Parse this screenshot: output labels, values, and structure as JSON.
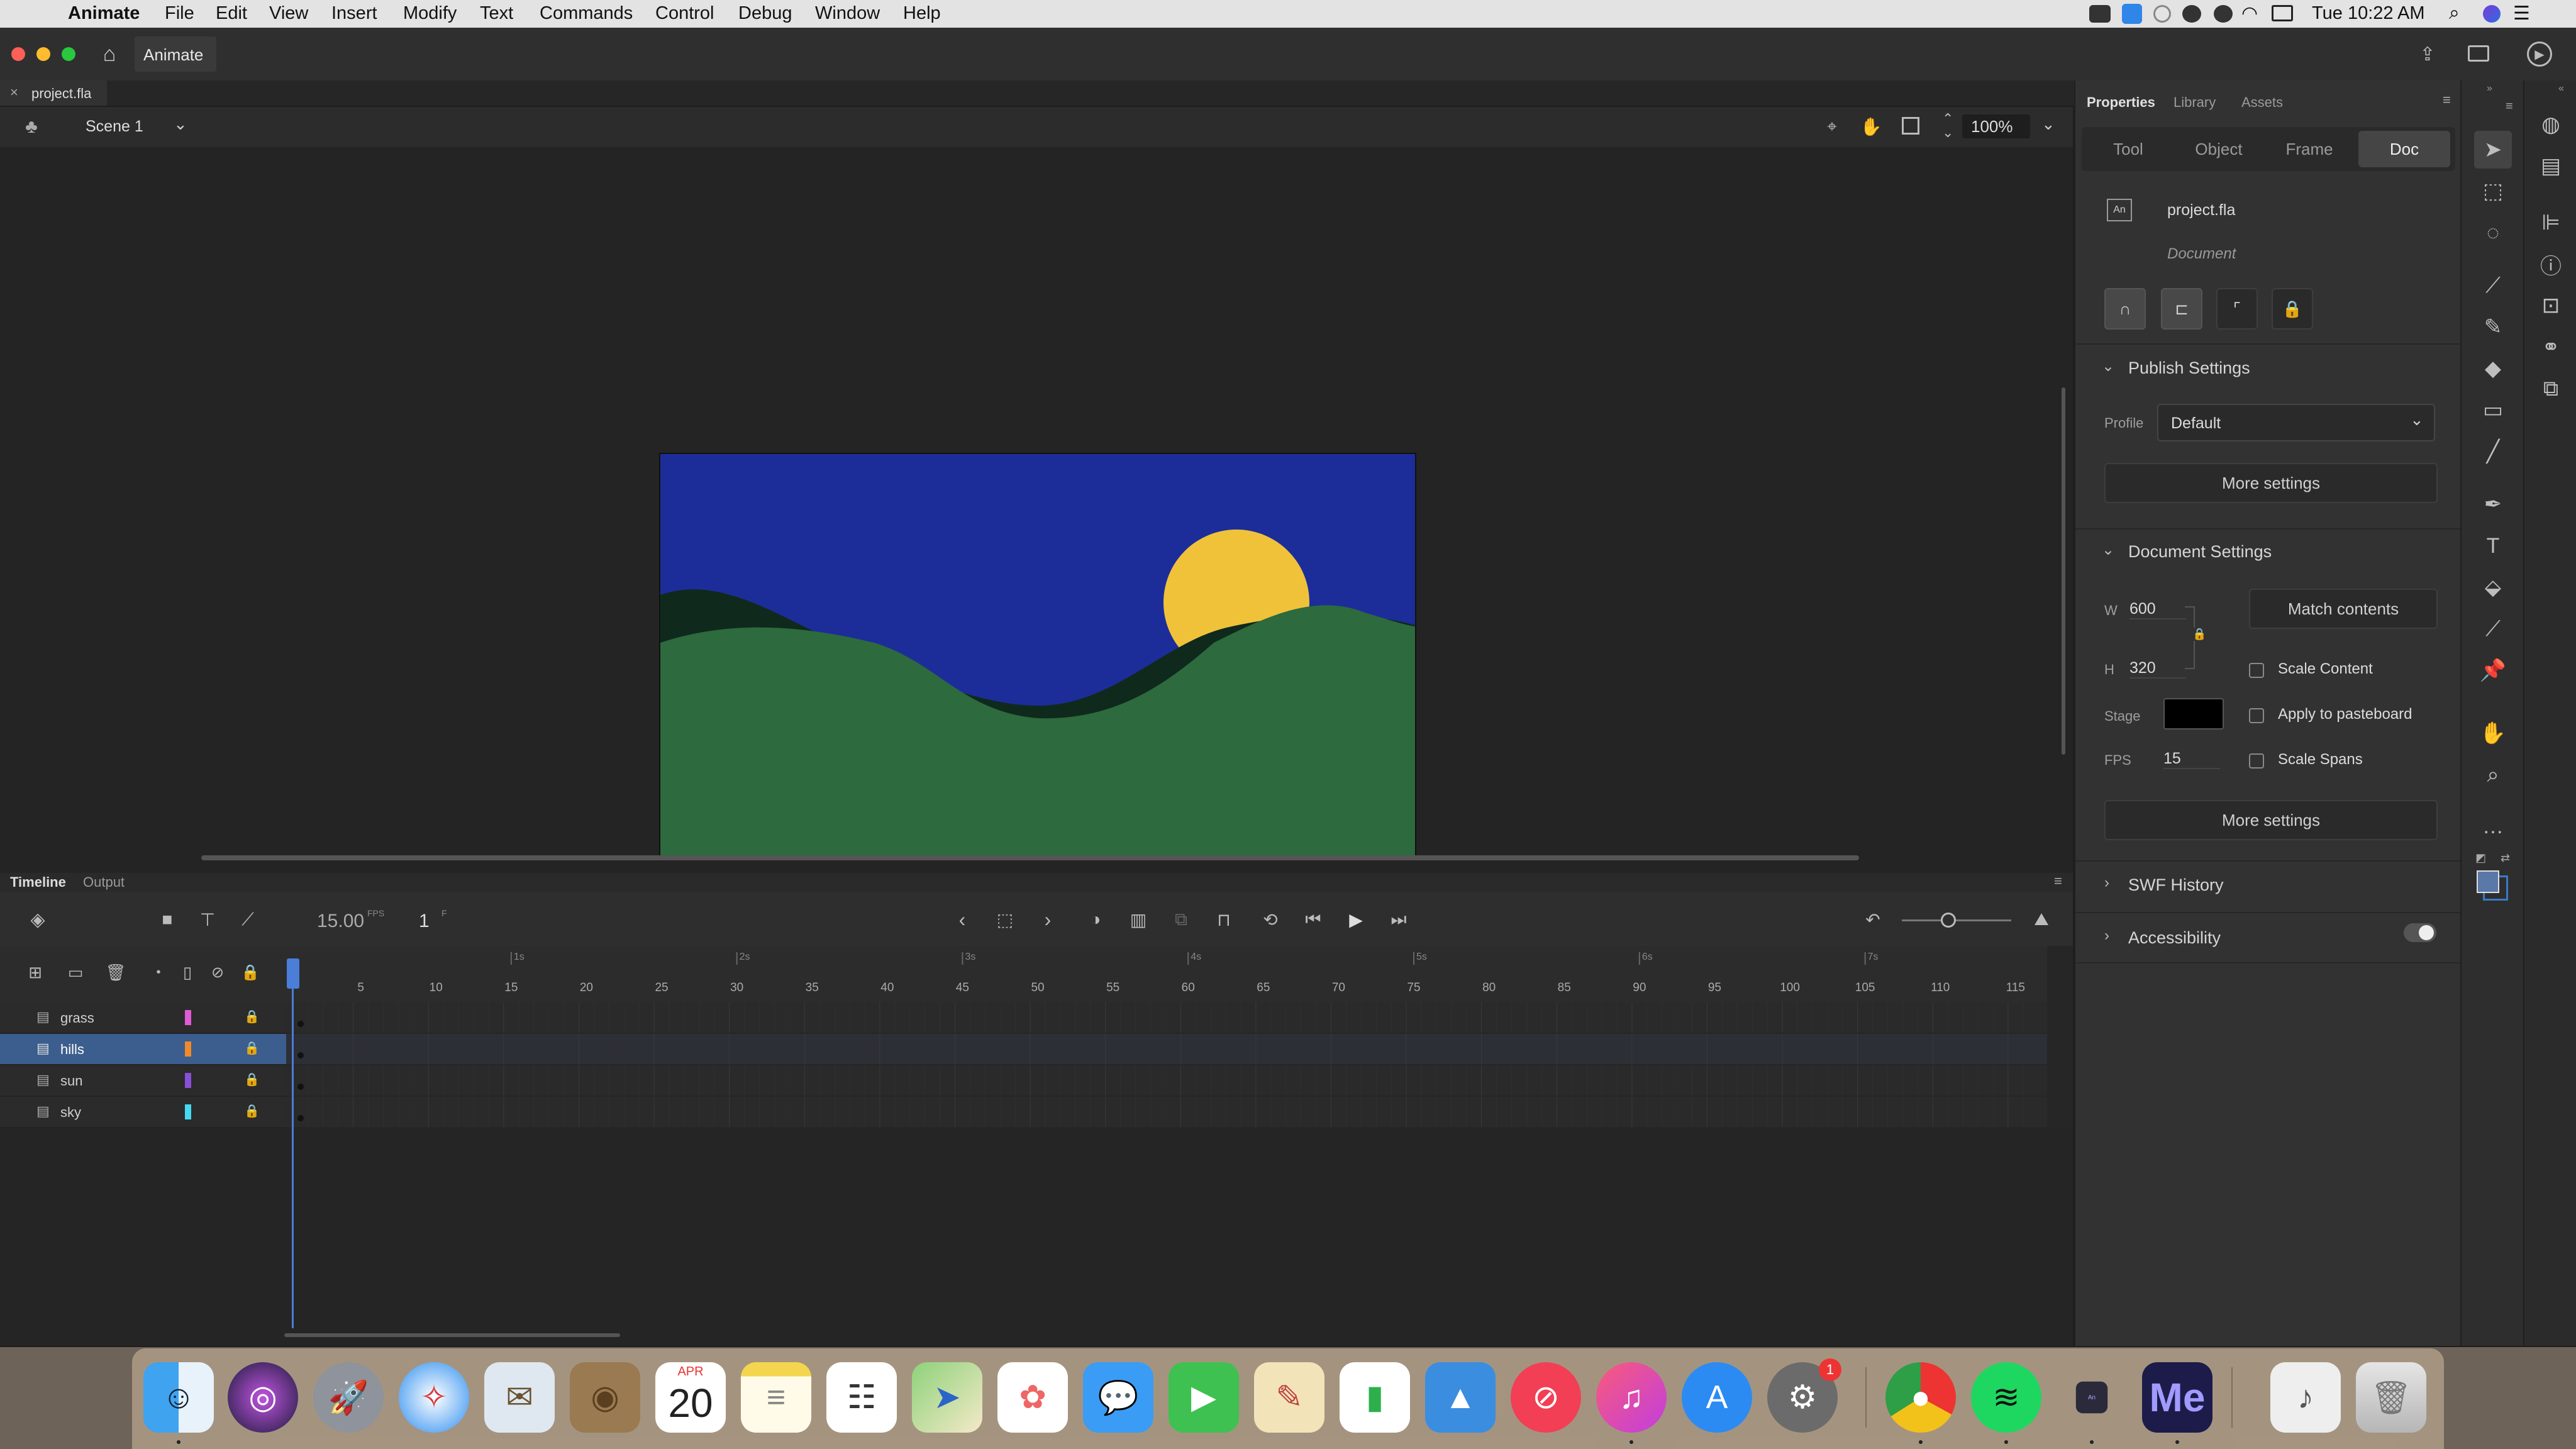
{
  "menubar": {
    "app_name": "Animate",
    "items": [
      "File",
      "Edit",
      "View",
      "Insert",
      "Modify",
      "Text",
      "Commands",
      "Control",
      "Debug",
      "Window",
      "Help"
    ],
    "clock": "Tue 10:22 AM"
  },
  "titlebar": {
    "app_label": "Animate"
  },
  "document": {
    "tab_name": "project.fla"
  },
  "scene": {
    "name": "Scene 1",
    "zoom": "100%"
  },
  "stage": {
    "colors": {
      "sky": "#1c2d9a",
      "sun": "#f0c23a",
      "hills": "#0f2a1c",
      "grass": "#2d6a3d"
    }
  },
  "timeline": {
    "tabs": [
      "Timeline",
      "Output"
    ],
    "fps": "15.00",
    "fps_unit": "FPS",
    "current_frame": "1",
    "frame_unit": "F",
    "seconds": [
      "1s",
      "2s",
      "3s",
      "4s",
      "5s",
      "6s",
      "7s"
    ],
    "frame_ticks": [
      "5",
      "10",
      "15",
      "20",
      "25",
      "30",
      "35",
      "40",
      "45",
      "50",
      "55",
      "60",
      "65",
      "70",
      "75",
      "80",
      "85",
      "90",
      "95",
      "100",
      "105",
      "110",
      "115"
    ],
    "layers": [
      {
        "name": "grass",
        "color": "#e05bd6"
      },
      {
        "name": "hills",
        "color": "#f08a2a"
      },
      {
        "name": "sun",
        "color": "#8a4fd8"
      },
      {
        "name": "sky",
        "color": "#45d8f0"
      }
    ]
  },
  "properties": {
    "panel_tabs": [
      "Properties",
      "Library",
      "Assets"
    ],
    "mode_tabs": [
      "Tool",
      "Object",
      "Frame",
      "Doc"
    ],
    "doc_icon": "An",
    "doc_name": "project.fla",
    "doc_type": "Document",
    "publish": {
      "title": "Publish Settings",
      "profile_label": "Profile",
      "profile_value": "Default",
      "more": "More settings"
    },
    "docsettings": {
      "title": "Document Settings",
      "w_label": "W",
      "w_value": "600",
      "h_label": "H",
      "h_value": "320",
      "match": "Match contents",
      "stage_label": "Stage",
      "stage_color": "#000000",
      "fps_label": "FPS",
      "fps_value": "15",
      "scale_content": "Scale Content",
      "apply_pasteboard": "Apply to pasteboard",
      "scale_spans": "Scale Spans",
      "more": "More settings"
    },
    "swf_history": "SWF History",
    "accessibility": "Accessibility"
  },
  "dock": {
    "calendar_month": "APR",
    "calendar_day": "20",
    "settings_badge": "1",
    "media_encoder": "Me",
    "animate_small": "An"
  }
}
